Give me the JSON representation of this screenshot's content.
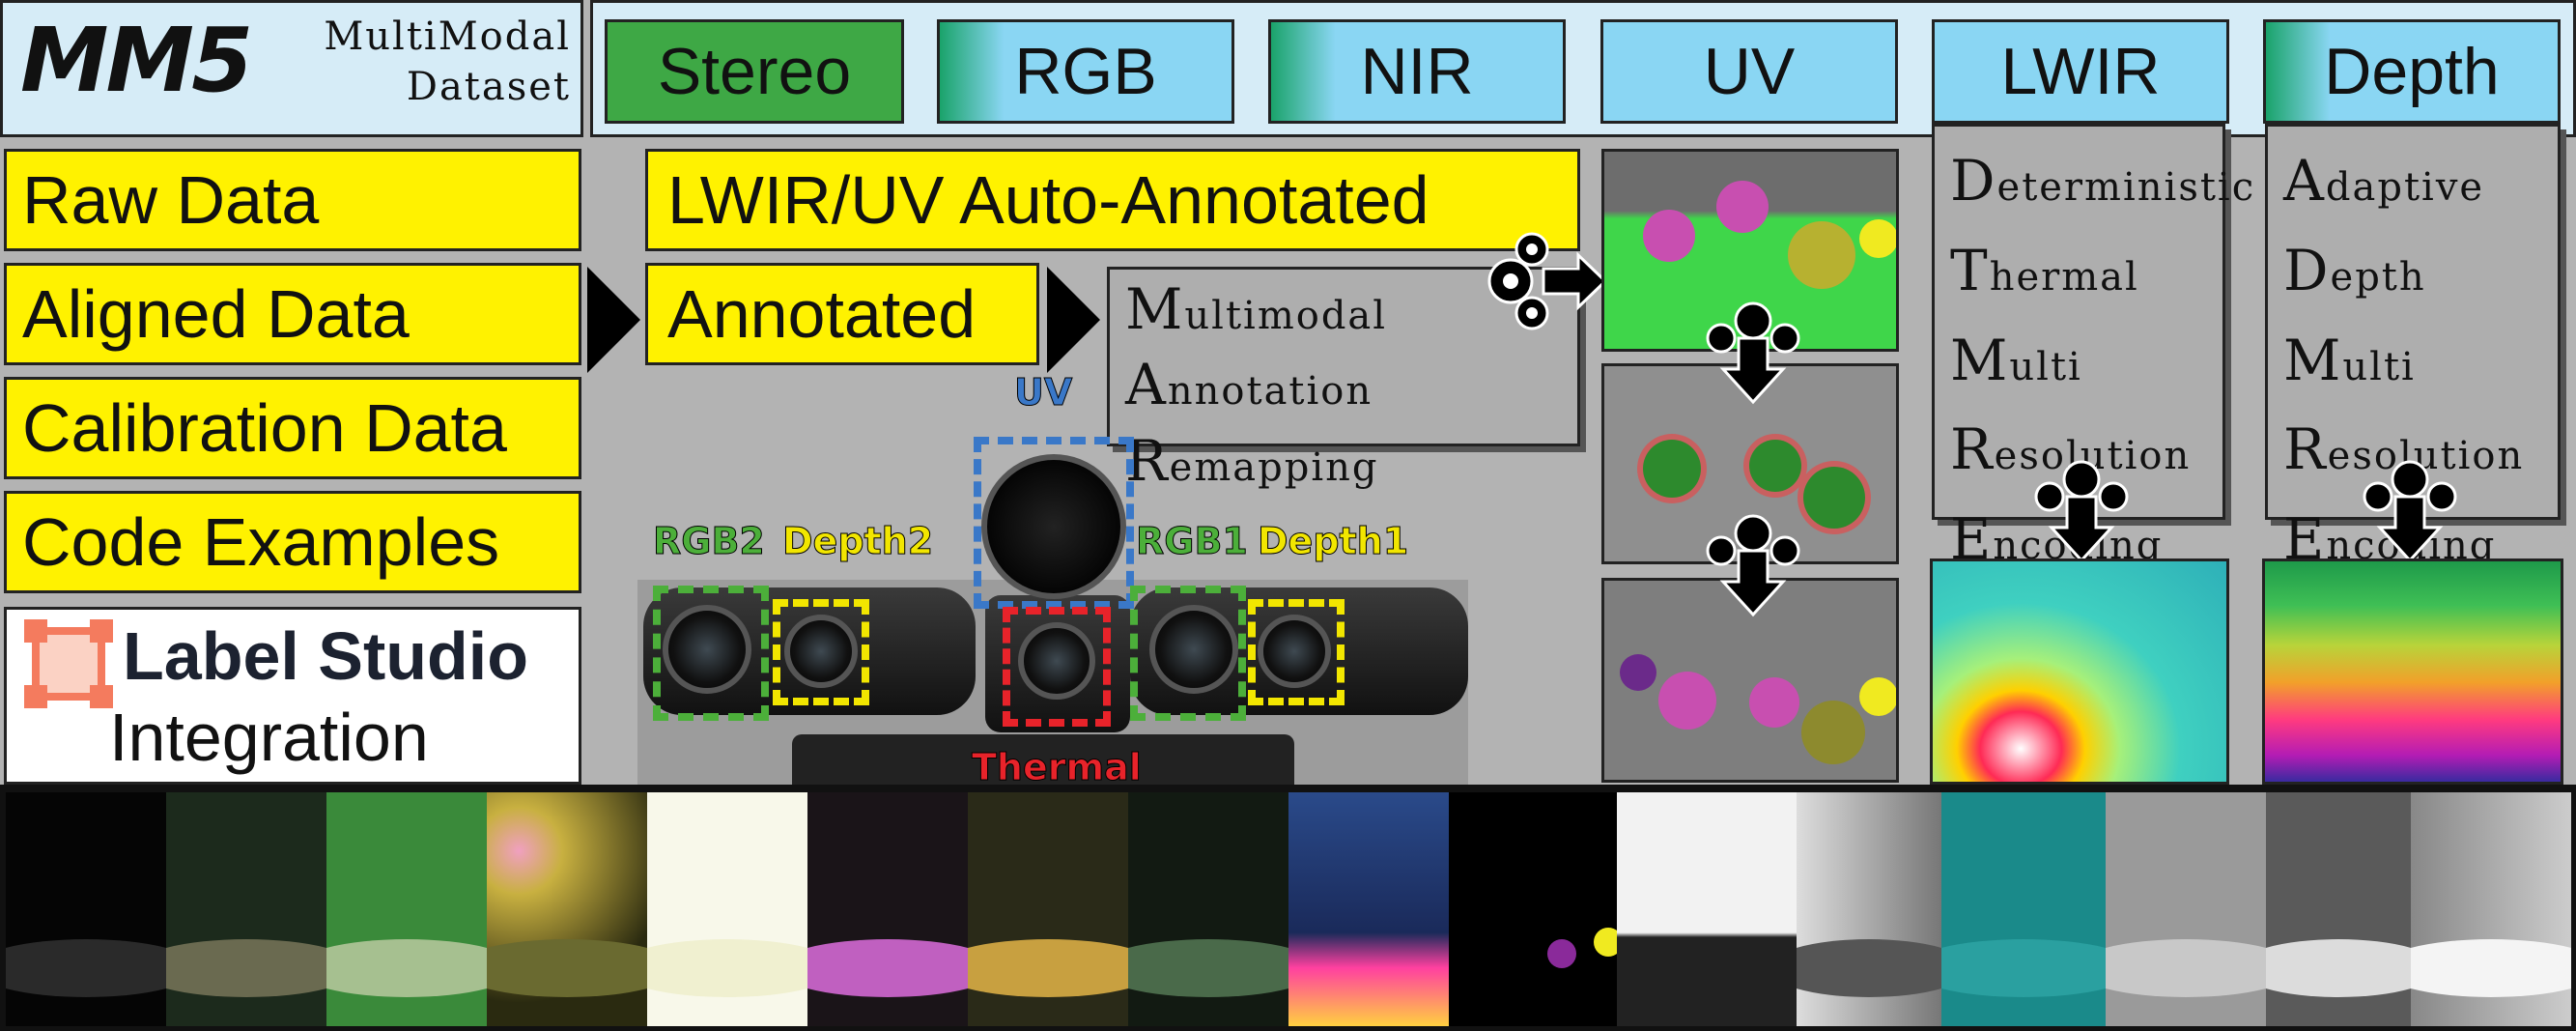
{
  "header": {
    "title": "MM5",
    "subtitle_line1": "MultiModal",
    "subtitle_line2": "Dataset",
    "modalities": [
      "Stereo",
      "RGB",
      "NIR",
      "UV",
      "LWIR",
      "Depth"
    ]
  },
  "data_items": [
    "Raw Data",
    "Aligned Data",
    "Calibration Data",
    "Code Examples"
  ],
  "label_studio": {
    "name": "Label Studio",
    "line2": "Integration"
  },
  "annotations": {
    "auto": "LWIR/UV Auto-Annotated",
    "annotated": "Annotated"
  },
  "mar": {
    "lines": [
      {
        "initial": "M",
        "rest": "ultimodal"
      },
      {
        "initial": "A",
        "rest": "nnotation"
      },
      {
        "initial": "R",
        "rest": "emapping"
      }
    ]
  },
  "dtmre": {
    "lines": [
      {
        "initial": "D",
        "rest": "eterministic"
      },
      {
        "initial": "T",
        "rest": "hermal"
      },
      {
        "initial": "M",
        "rest": "ulti"
      },
      {
        "initial": "R",
        "rest": "esolution"
      },
      {
        "initial": "E",
        "rest": "ncoding"
      }
    ]
  },
  "admre": {
    "lines": [
      {
        "initial": "A",
        "rest": "daptive"
      },
      {
        "initial": "D",
        "rest": "epth"
      },
      {
        "initial": "M",
        "rest": "ulti"
      },
      {
        "initial": "R",
        "rest": "esolution"
      },
      {
        "initial": "E",
        "rest": "ncoding"
      }
    ]
  },
  "camera_labels": {
    "uv": "UV",
    "rgb2": "RGB2",
    "depth2": "Depth2",
    "rgb1": "RGB1",
    "depth1": "Depth1",
    "thermal": "Thermal"
  },
  "colors": {
    "header_bg": "#d6ecf7",
    "modality_bg": "#8ad6f3",
    "stereo_green": "#3ea845",
    "yellow": "#fff200",
    "uv_dash": "#3a78c8",
    "rgb_dash": "#4caf3a",
    "depth_dash": "#f2e600",
    "thermal_dash": "#e8232a",
    "label_studio_orange": "#f47b5e"
  },
  "icons": [
    "gear-cluster-icon",
    "down-arrow-icon",
    "right-arrow-icon",
    "label-studio-logo-icon"
  ]
}
